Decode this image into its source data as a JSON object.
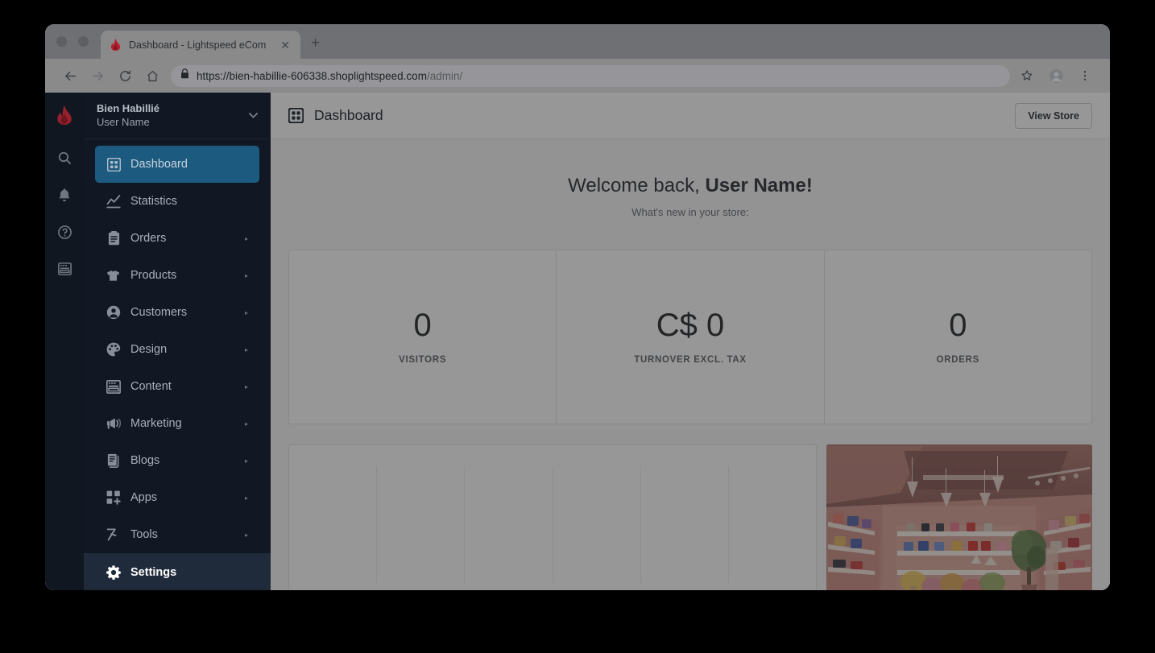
{
  "browser": {
    "tab": {
      "title": "Dashboard - Lightspeed eCom",
      "favicon": "lightspeed-flame-icon",
      "close_label": "✕"
    },
    "new_tab_label": "+",
    "window_controls": [
      "close",
      "minimize",
      "maximize"
    ],
    "toolbar": {
      "back_label": "←",
      "forward_label": "→",
      "reload_label": "⟳",
      "home_label": "⌂",
      "url_scheme_host": "https://bien-habillie-606338.shoplightspeed.com",
      "url_path": "/admin/",
      "bookmark_icon": "star-icon",
      "profile_icon": "avatar-icon",
      "menu_icon": "three-dots-icon"
    }
  },
  "rail": {
    "logo": "lightspeed-flame-logo",
    "icons": [
      {
        "name": "search-icon",
        "label": "Search"
      },
      {
        "name": "notifications-bell-icon",
        "label": "Notifications"
      },
      {
        "name": "help-circle-icon",
        "label": "Help"
      },
      {
        "name": "news-icon",
        "label": "News"
      }
    ]
  },
  "sidebar": {
    "store_name": "Bien Habillié",
    "user_name": "User Name",
    "dropdown_caret": "▾",
    "items": [
      {
        "label": "Dashboard",
        "icon": "dashboard-grid-icon",
        "active": true,
        "has_arrow": false
      },
      {
        "label": "Statistics",
        "icon": "line-chart-icon",
        "active": false,
        "has_arrow": false
      },
      {
        "label": "Orders",
        "icon": "clipboard-icon",
        "active": false,
        "has_arrow": true
      },
      {
        "label": "Products",
        "icon": "tshirt-icon",
        "active": false,
        "has_arrow": true
      },
      {
        "label": "Customers",
        "icon": "user-circle-icon",
        "active": false,
        "has_arrow": true
      },
      {
        "label": "Design",
        "icon": "palette-icon",
        "active": false,
        "has_arrow": true
      },
      {
        "label": "Content",
        "icon": "layout-icon",
        "active": false,
        "has_arrow": true
      },
      {
        "label": "Marketing",
        "icon": "megaphone-icon",
        "active": false,
        "has_arrow": true
      },
      {
        "label": "Blogs",
        "icon": "documents-icon",
        "active": false,
        "has_arrow": true
      },
      {
        "label": "Apps",
        "icon": "apps-plus-icon",
        "active": false,
        "has_arrow": true
      },
      {
        "label": "Tools",
        "icon": "wrench-icon",
        "active": false,
        "has_arrow": true
      }
    ],
    "settings": {
      "label": "Settings",
      "icon": "gear-icon",
      "selected": true
    },
    "arrow_glyph": "▸"
  },
  "main": {
    "header": {
      "icon": "dashboard-grid-icon",
      "title": "Dashboard",
      "view_store_label": "View Store"
    },
    "welcome_prefix": "Welcome back, ",
    "welcome_name": "User Name!",
    "subtitle": "What's new in your store:",
    "stats": [
      {
        "value": "0",
        "label": "VISITORS"
      },
      {
        "value": "C$ 0",
        "label": "TURNOVER EXCL. TAX"
      },
      {
        "value": "0",
        "label": "ORDERS"
      }
    ],
    "chart_panel": {
      "name": "empty-chart-panel",
      "gridline_count": 6
    },
    "promo_image": {
      "name": "store-interior-photo",
      "alt": "Pink retail boutique interior with shelves of handbags"
    }
  },
  "colors": {
    "sidebar_bg": "#111823",
    "rail_bg": "#101720",
    "active_nav": "#1d5a80",
    "settings_bg": "#1f2a3a",
    "brand_red": "#a02433",
    "overlay": "rgba(34,34,34,0.47)"
  }
}
